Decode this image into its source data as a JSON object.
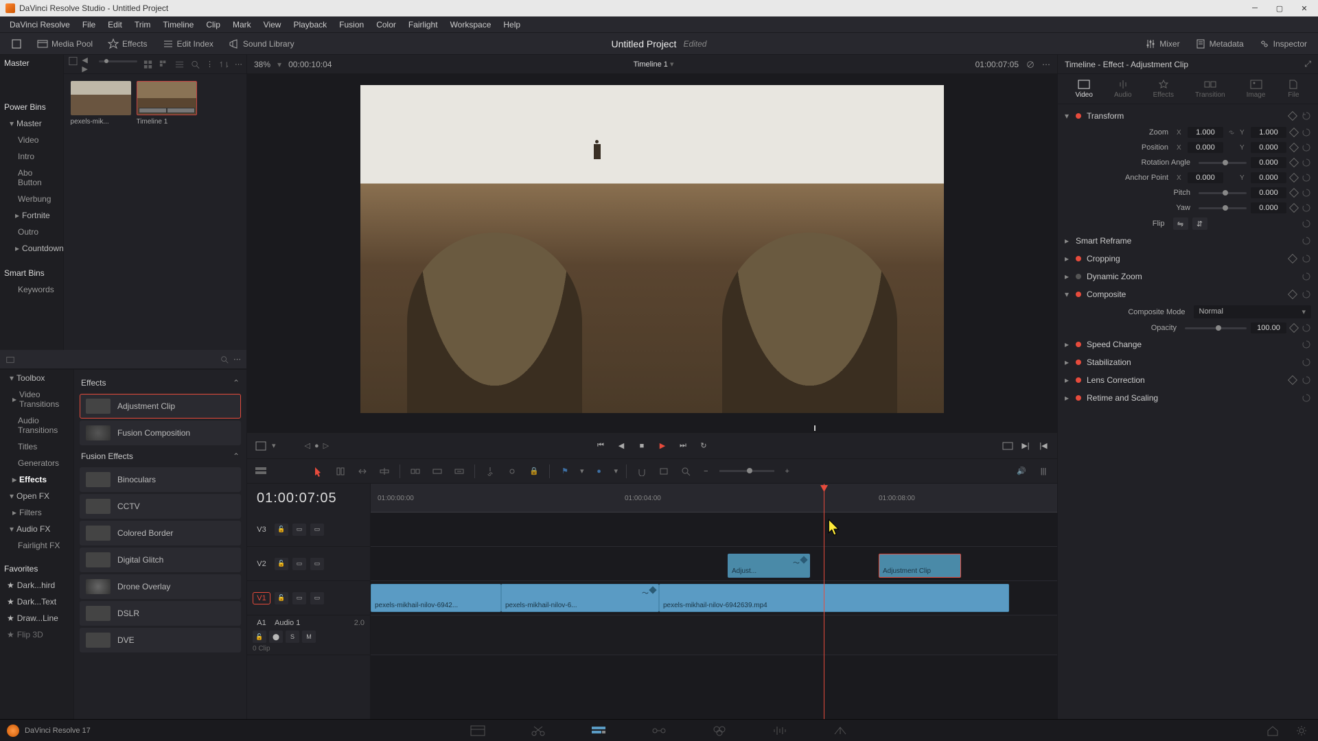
{
  "titlebar": {
    "text": "DaVinci Resolve Studio - Untitled Project"
  },
  "menu": [
    "DaVinci Resolve",
    "File",
    "Edit",
    "Trim",
    "Timeline",
    "Clip",
    "Mark",
    "View",
    "Playback",
    "Fusion",
    "Color",
    "Fairlight",
    "Workspace",
    "Help"
  ],
  "toolbar": {
    "media_pool": "Media Pool",
    "effects": "Effects",
    "edit_index": "Edit Index",
    "sound_library": "Sound Library",
    "mixer": "Mixer",
    "metadata": "Metadata",
    "inspector": "Inspector",
    "project_title": "Untitled Project",
    "project_status": "Edited"
  },
  "media_tree": {
    "master": "Master",
    "power_bins": "Power Bins",
    "power_items": [
      "Master",
      "Video",
      "Intro",
      "Abo Button",
      "Werbung",
      "Fortnite",
      "Outro",
      "Countdown"
    ],
    "smart_bins": "Smart Bins",
    "smart_items": [
      "Keywords"
    ]
  },
  "thumbs": [
    {
      "name": "pexels-mik..."
    },
    {
      "name": "Timeline 1"
    }
  ],
  "fx_tree": {
    "toolbox": "Toolbox",
    "toolbox_items": [
      "Video Transitions",
      "Audio Transitions",
      "Titles",
      "Generators",
      "Effects"
    ],
    "open_fx": "Open FX",
    "open_fx_items": [
      "Filters"
    ],
    "audio_fx": "Audio FX",
    "audio_fx_items": [
      "Fairlight FX"
    ],
    "favorites": "Favorites",
    "fav_items": [
      "Dark...hird",
      "Dark...Text",
      "Draw...Line",
      "Flip 3D"
    ]
  },
  "fx_list": {
    "section1": "Effects",
    "effects_items": [
      "Adjustment Clip",
      "Fusion Composition"
    ],
    "section2": "Fusion Effects",
    "fusion_items": [
      "Binoculars",
      "CCTV",
      "Colored Border",
      "Digital Glitch",
      "Drone Overlay",
      "DSLR",
      "DVE"
    ]
  },
  "viewer": {
    "zoom": "38%",
    "tc_left": "00:00:10:04",
    "title": "Timeline 1",
    "tc_right": "01:00:07:05"
  },
  "timeline": {
    "tc": "01:00:07:05",
    "ruler": [
      "01:00:00:00",
      "01:00:04:00",
      "01:00:08:00"
    ],
    "tracks": {
      "v3": "V3",
      "v2": "V2",
      "v1": "V1",
      "a1": "A1",
      "a1_name": "Audio 1",
      "a1_ch": "2.0",
      "a1_clips": "0 Clip"
    },
    "clips": {
      "v1_1": "pexels-mikhail-nilov-6942...",
      "v1_2": "pexels-mikhail-nilov-6...",
      "v1_3": "pexels-mikhail-nilov-6942639.mp4",
      "adj1": "Adjust...",
      "adj2": "Adjustment Clip"
    }
  },
  "inspector": {
    "title": "Timeline - Effect - Adjustment Clip",
    "tabs": [
      "Video",
      "Audio",
      "Effects",
      "Transition",
      "Image",
      "File"
    ],
    "transform": {
      "label": "Transform",
      "zoom": "Zoom",
      "zoom_x": "1.000",
      "zoom_y": "1.000",
      "position": "Position",
      "pos_x": "0.000",
      "pos_y": "0.000",
      "rotation": "Rotation Angle",
      "rot_val": "0.000",
      "anchor": "Anchor Point",
      "anc_x": "0.000",
      "anc_y": "0.000",
      "pitch": "Pitch",
      "pitch_val": "0.000",
      "yaw": "Yaw",
      "yaw_val": "0.000",
      "flip": "Flip"
    },
    "sections": {
      "smart_reframe": "Smart Reframe",
      "cropping": "Cropping",
      "dynamic_zoom": "Dynamic Zoom",
      "composite": "Composite",
      "composite_mode": "Composite Mode",
      "composite_mode_val": "Normal",
      "opacity": "Opacity",
      "opacity_val": "100.00",
      "speed_change": "Speed Change",
      "stabilization": "Stabilization",
      "lens_correction": "Lens Correction",
      "retime": "Retime and Scaling"
    }
  },
  "bottom": {
    "version": "DaVinci Resolve 17"
  }
}
